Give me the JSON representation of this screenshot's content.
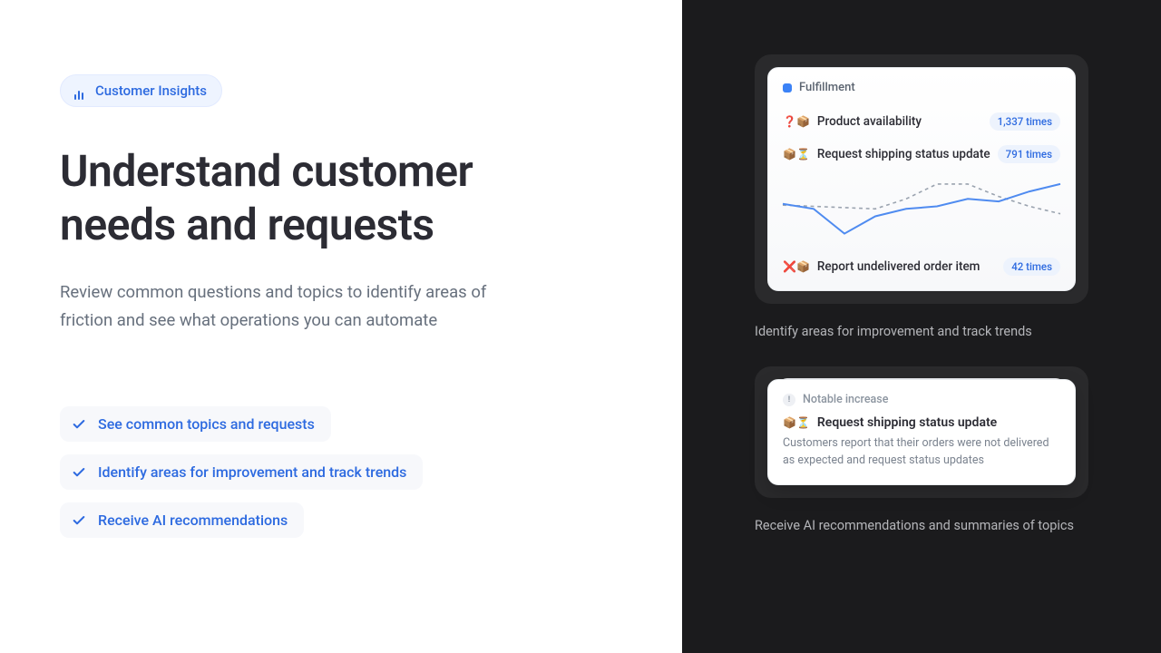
{
  "tag": {
    "label": "Customer Insights"
  },
  "hero": {
    "title": "Understand customer needs and requests",
    "subtitle": "Review common questions and topics to identify areas of friction and see what operations you can automate"
  },
  "bullets": [
    "See common topics and requests",
    "Identify areas for improvement and track trends",
    "Receive AI recommendations"
  ],
  "card1": {
    "header": "Fulfillment",
    "rows": [
      {
        "emoji": "❓📦",
        "label": "Product availability",
        "badge": "1,337 times"
      },
      {
        "emoji": "📦⏳",
        "label": "Request shipping status update",
        "badge": "791 times"
      },
      {
        "emoji": "❌📦",
        "label": "Report undelivered order item",
        "badge": "42 times"
      }
    ],
    "caption": "Identify areas for improvement and track trends"
  },
  "card2": {
    "notable": "Notable increase",
    "title_emoji": "📦⏳",
    "title": "Request shipping status update",
    "desc": "Customers report that their orders were not delivered as expected and request status updates",
    "caption": "Receive AI recommendations and summaries of topics"
  },
  "chart_data": {
    "type": "line",
    "title": "",
    "xlabel": "",
    "ylabel": "",
    "x": [
      0,
      1,
      2,
      3,
      4,
      5,
      6,
      7,
      8,
      9
    ],
    "series": [
      {
        "name": "series-a",
        "values": [
          56,
          52,
          32,
          46,
          52,
          54,
          60,
          58,
          66,
          72
        ],
        "style": "solid",
        "color": "#4f8bf0"
      },
      {
        "name": "series-b",
        "values": [
          55,
          54,
          53,
          52,
          60,
          72,
          72,
          62,
          54,
          48
        ],
        "style": "dashed",
        "color": "#9aa3af"
      }
    ],
    "ylim": [
      20,
      80
    ]
  }
}
